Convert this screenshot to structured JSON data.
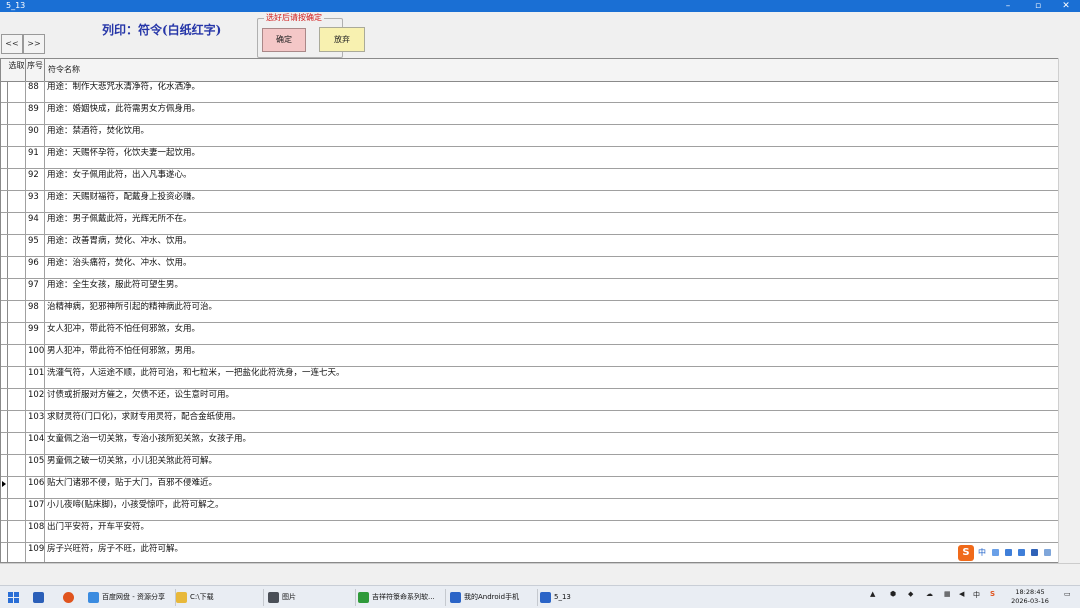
{
  "window": {
    "title": "5_13",
    "min_glyph": "–",
    "max_glyph": "▫",
    "close_glyph": "✕"
  },
  "toolbar": {
    "prev_label": "<<",
    "next_label": ">>",
    "heading": "列印：符令(白纸红字)",
    "group_legend": "选好后请按确定",
    "ok_label": "确定",
    "cancel_label": "放弃"
  },
  "table": {
    "headers": {
      "select": "选取",
      "no": "序号",
      "name": "符令名称"
    },
    "rows": [
      {
        "no": "88",
        "name": "用途：制作大悲咒水清净符，化水洒净。"
      },
      {
        "no": "89",
        "name": "用途：婚姻快成，此符需男女方佩身用。"
      },
      {
        "no": "90",
        "name": "用途：禁酒符，焚化饮用。"
      },
      {
        "no": "91",
        "name": "用途：天赐怀孕符，化饮夫妻一起饮用。"
      },
      {
        "no": "92",
        "name": "用途：女子佩用此符，出入凡事遂心。"
      },
      {
        "no": "93",
        "name": "用途：天赐财福符，配戴身上投资必赚。"
      },
      {
        "no": "94",
        "name": "用途：男子佩戴此符，光辉无所不在。"
      },
      {
        "no": "95",
        "name": "用途：改善胃病，焚化、冲水、饮用。"
      },
      {
        "no": "96",
        "name": "用途：治头痛符，焚化、冲水、饮用。"
      },
      {
        "no": "97",
        "name": "用途：全生女孩，服此符可望生男。"
      },
      {
        "no": "98",
        "name": "治精神病，犯邪神所引起的精神病此符可治。"
      },
      {
        "no": "99",
        "name": "女人犯冲，带此符不怕任何邪煞，女用。"
      },
      {
        "no": "100",
        "name": "男人犯冲，带此符不怕任何邪煞，男用。"
      },
      {
        "no": "101",
        "name": "洗灌气符，人运途不顺，此符可治，和七粒米，一把盐化此符洗身，一连七天。"
      },
      {
        "no": "102",
        "name": "讨债或折服对方催之，欠债不还，讼生意时可用。"
      },
      {
        "no": "103",
        "name": "求财灵符(门口化)，求财专用灵符，配合金纸使用。"
      },
      {
        "no": "104",
        "name": "女童佩之治一切关煞，专治小孩所犯关煞，女孩子用。"
      },
      {
        "no": "105",
        "name": "男童佩之破一切关煞，小儿犯关煞此符可解。"
      },
      {
        "no": "106",
        "name": "贴大门诸邪不侵，贴于大门，百邪不侵难近。"
      },
      {
        "no": "107",
        "name": "小儿夜啼(贴床脚)，小孩受惊吓，此符可解之。"
      },
      {
        "no": "108",
        "name": "出门平安符，开车平安符。"
      },
      {
        "no": "109",
        "name": "房子兴旺符，房子不旺，此符可解。"
      }
    ]
  },
  "ime": {
    "logo": "S",
    "mode": "中"
  },
  "taskbar": {
    "items": [
      {
        "label": "百度网盘 - 资源分享",
        "color": "#3a8be0"
      },
      {
        "label": "C:\\下载",
        "color": "#e8b83a"
      },
      {
        "label": "图片",
        "color": "#4a4f57"
      },
      {
        "label": "吉祥符箓命系列软...",
        "color": "#2f9a3a"
      },
      {
        "label": "我的Android手机",
        "color": "#2b64c7"
      },
      {
        "label": "5_13",
        "color": "#2b64c7"
      }
    ],
    "tray_lang": "中",
    "time": "18:28:45",
    "date": "2026-03-16"
  }
}
